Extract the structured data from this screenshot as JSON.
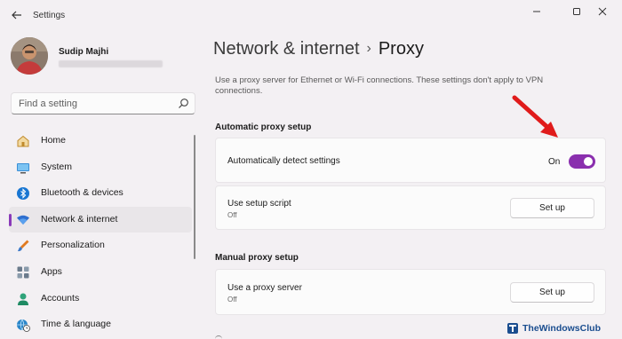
{
  "app": {
    "title": "Settings",
    "user_name": "Sudip Majhi"
  },
  "search": {
    "placeholder": "Find a setting"
  },
  "sidebar": {
    "items": [
      {
        "label": "Home",
        "icon": "home-icon"
      },
      {
        "label": "System",
        "icon": "monitor-icon"
      },
      {
        "label": "Bluetooth & devices",
        "icon": "bluetooth-icon"
      },
      {
        "label": "Network & internet",
        "icon": "wifi-icon",
        "active": true
      },
      {
        "label": "Personalization",
        "icon": "brush-icon"
      },
      {
        "label": "Apps",
        "icon": "apps-icon"
      },
      {
        "label": "Accounts",
        "icon": "person-icon"
      },
      {
        "label": "Time & language",
        "icon": "globe-clock-icon"
      }
    ]
  },
  "header": {
    "parent": "Network & internet",
    "separator": "›",
    "current": "Proxy"
  },
  "main": {
    "description": "Use a proxy server for Ethernet or Wi-Fi connections. These settings don't apply to VPN connections.",
    "automatic": {
      "title": "Automatic proxy setup",
      "detect_label": "Automatically detect settings",
      "detect_state": "On",
      "script_label": "Use setup script",
      "script_state": "Off",
      "script_button": "Set up"
    },
    "manual": {
      "title": "Manual proxy setup",
      "proxy_label": "Use a proxy server",
      "proxy_state": "Off",
      "proxy_button": "Set up"
    }
  },
  "watermark": {
    "text": "TheWindowsClub"
  },
  "colors": {
    "accent": "#8a2fae",
    "annotation_arrow": "#e01b1b",
    "background": "#f3f0f3",
    "card": "#fbfbfb"
  }
}
